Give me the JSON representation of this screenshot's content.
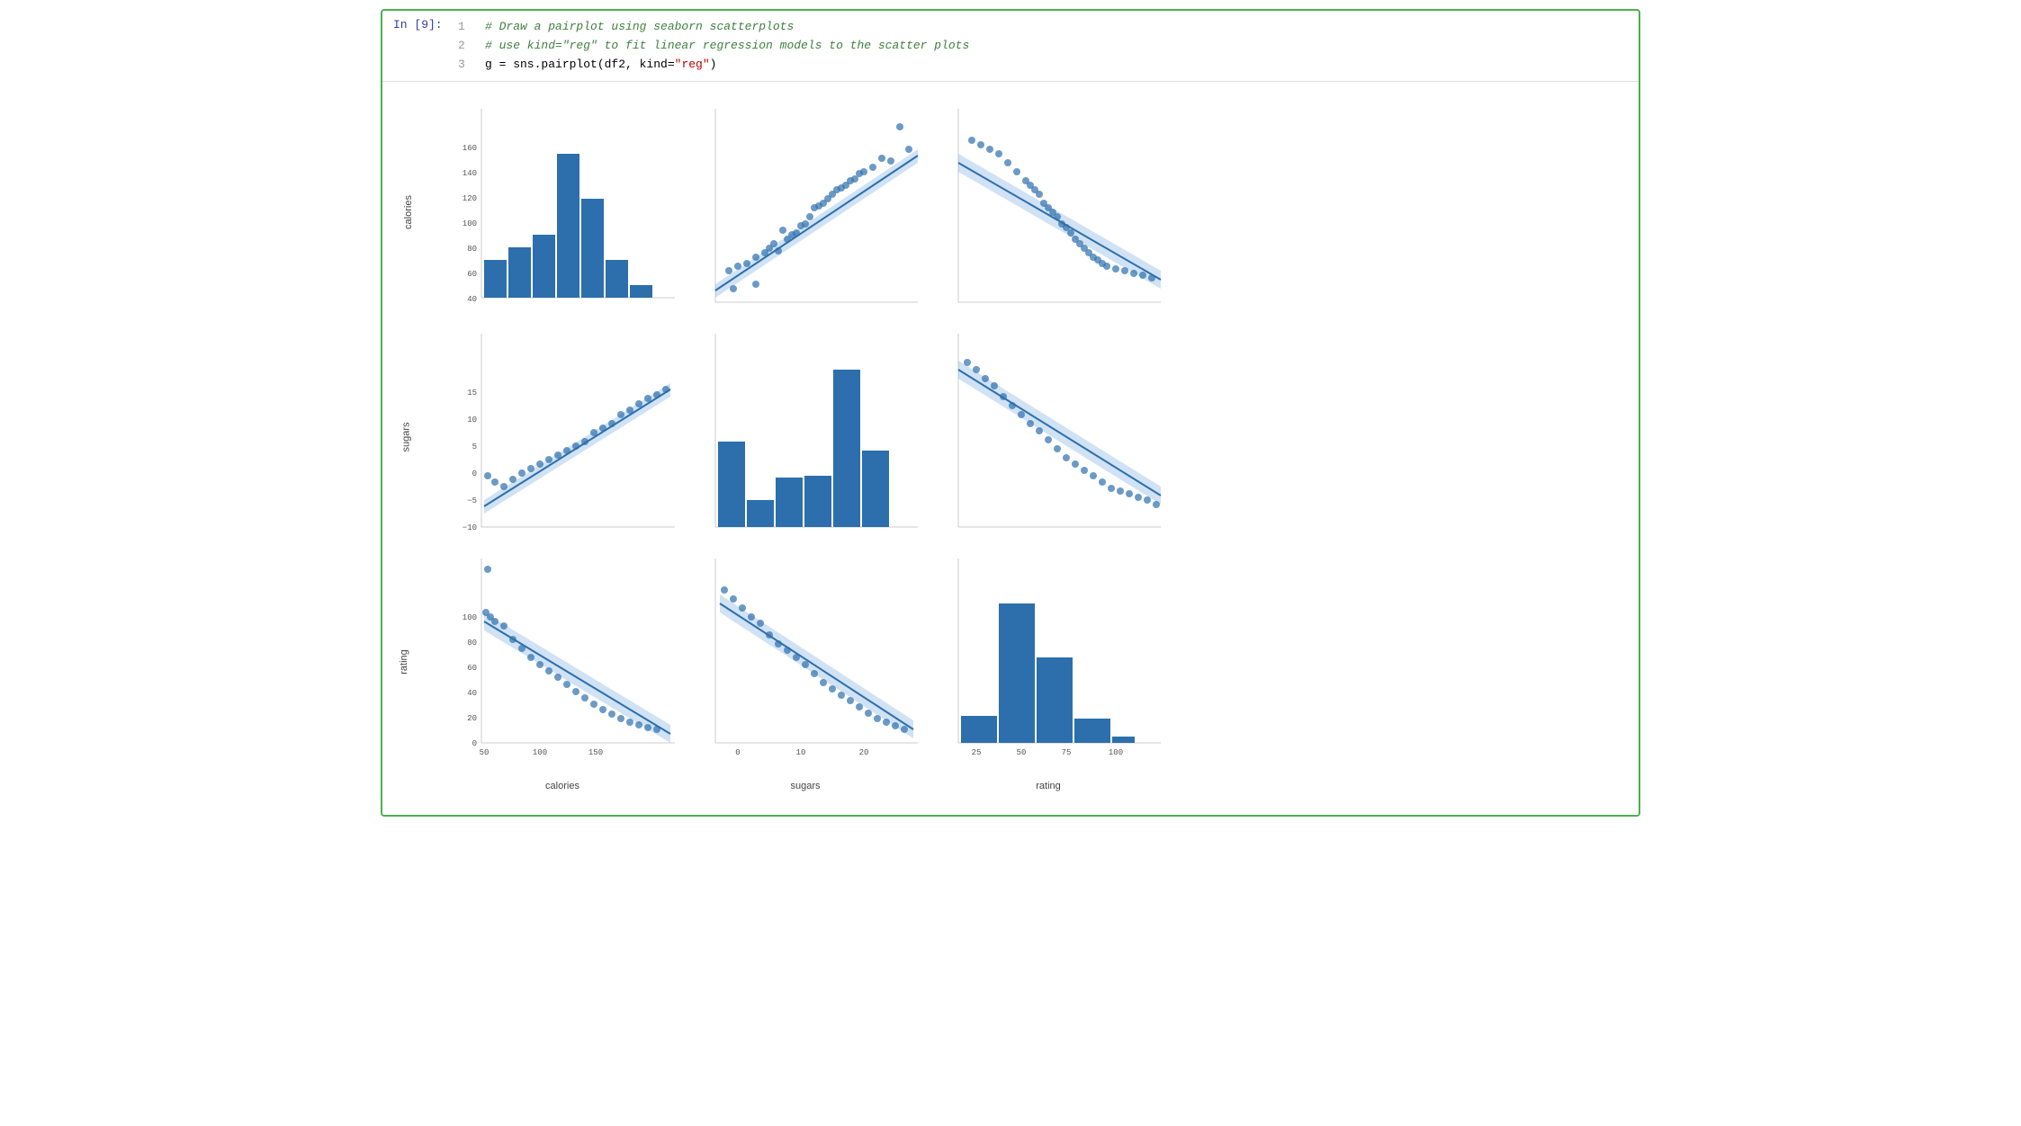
{
  "cell": {
    "label": "In [9]:",
    "lines": [
      {
        "num": "1",
        "parts": [
          {
            "text": "# Draw a pairplot using seaborn scatterplots",
            "class": "c-comment"
          }
        ]
      },
      {
        "num": "2",
        "parts": [
          {
            "text": "# use kind=\"reg\" to fit linear regression models to the scatter plots",
            "class": "c-comment"
          }
        ]
      },
      {
        "num": "3",
        "parts": [
          {
            "text": "g = sns.pairplot(df2, kind=",
            "class": "c-normal"
          },
          {
            "text": "\"reg\"",
            "class": "c-string-red"
          },
          {
            "text": ")",
            "class": "c-normal"
          }
        ]
      }
    ]
  },
  "plot": {
    "rows": [
      "calories",
      "sugars",
      "rating"
    ],
    "cols": [
      "calories",
      "sugars",
      "rating"
    ],
    "accent_color": "#2c6fac",
    "ci_color": "rgba(100,160,220,0.3)"
  }
}
